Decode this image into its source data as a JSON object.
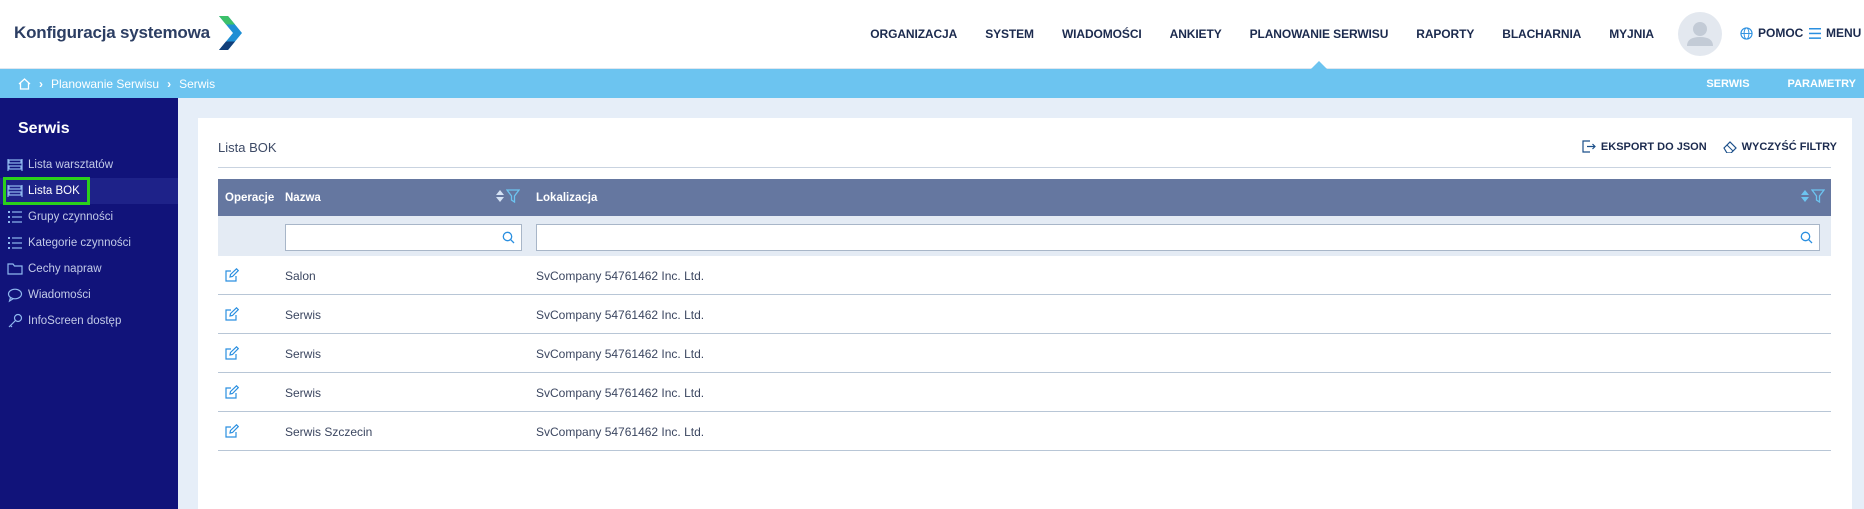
{
  "header": {
    "brand_title": "Konfiguracja systemowa",
    "nav": [
      {
        "label": "ORGANIZACJA",
        "active": false
      },
      {
        "label": "SYSTEM",
        "active": false
      },
      {
        "label": "WIADOMOŚCI",
        "active": false
      },
      {
        "label": "ANKIETY",
        "active": false
      },
      {
        "label": "PLANOWANIE SERWISU",
        "active": true
      },
      {
        "label": "RAPORTY",
        "active": false
      },
      {
        "label": "BLACHARNIA",
        "active": false
      },
      {
        "label": "MYJNIA",
        "active": false
      }
    ],
    "help_label": "POMOC",
    "menu_label": "MENU"
  },
  "breadcrumb": {
    "items": [
      "Planowanie Serwisu",
      "Serwis"
    ],
    "right_links": [
      "SERWIS",
      "PARAMETRY"
    ]
  },
  "sidebar": {
    "title": "Serwis",
    "items": [
      {
        "label": "Lista warsztatów",
        "icon": "workshop-icon",
        "active": false
      },
      {
        "label": "Lista BOK",
        "icon": "workshop-icon",
        "active": true
      },
      {
        "label": "Grupy czynności",
        "icon": "list-icon",
        "active": false
      },
      {
        "label": "Kategorie czynności",
        "icon": "list-icon",
        "active": false
      },
      {
        "label": "Cechy napraw",
        "icon": "folder-icon",
        "active": false
      },
      {
        "label": "Wiadomości",
        "icon": "chat-icon",
        "active": false
      },
      {
        "label": "InfoScreen dostęp",
        "icon": "key-icon",
        "active": false
      }
    ]
  },
  "panel": {
    "title": "Lista BOK",
    "export_label": "EKSPORT DO JSON",
    "clear_label": "WYCZYŚĆ FILTRY"
  },
  "table": {
    "columns": {
      "ops": "Operacje",
      "name": "Nazwa",
      "location": "Lokalizacja"
    },
    "filters": {
      "name": "",
      "location": ""
    },
    "rows": [
      {
        "name": "Salon",
        "location": "SvCompany 54761462 Inc. Ltd."
      },
      {
        "name": "Serwis",
        "location": "SvCompany 54761462 Inc. Ltd."
      },
      {
        "name": "Serwis",
        "location": "SvCompany 54761462 Inc. Ltd."
      },
      {
        "name": "Serwis",
        "location": "SvCompany 54761462 Inc. Ltd."
      },
      {
        "name": "Serwis Szczecin",
        "location": "SvCompany 54761462 Inc. Ltd."
      }
    ]
  },
  "colors": {
    "sidebar_bg": "#11137a",
    "accent": "#6cc4f0",
    "table_header": "#6577a0",
    "highlight": "#2bd11c"
  }
}
